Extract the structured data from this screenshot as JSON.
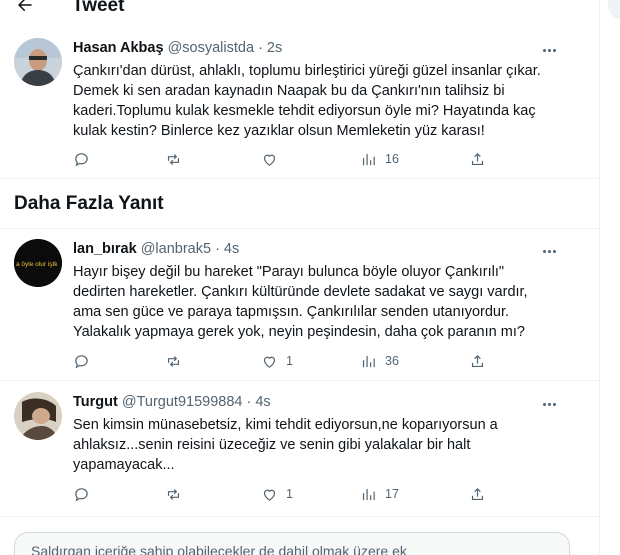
{
  "header": {
    "title": "Tweet"
  },
  "tweets": [
    {
      "name": "Hasan Akbaş",
      "handle": "@sosyalistda",
      "time": "· 2s",
      "text": "Çankırı'dan dürüst, ahlaklı, toplumu birleştirici yüreği güzel insanlar çıkar. Demek ki sen aradan kaynadın Naapak bu da Çankırı'nın talihsiz bi kaderi.Toplumu kulak kesmekle tehdit ediyorsun öyle mi? Hayatında kaç kulak kestin? Binlerce kez yazıklar olsun Memleketin yüz karası!",
      "likes": "",
      "views": "16"
    },
    {
      "name": "lan_bırak",
      "handle": "@lanbrak5",
      "time": "· 4s",
      "avatar_text": "a öyle olur iştk",
      "text": "Hayır bişey değil bu hareket \"Parayı bulunca böyle oluyor Çankırılı\" dedirten hareketler. Çankırı kültüründe devlete sadakat ve saygı vardır, ama sen güce ve paraya tapmışsın. Çankırılılar senden utanıyordur. Yalakalık yapmaya gerek yok, neyin peşindesin, daha çok paranın mı?",
      "likes": "1",
      "views": "36"
    },
    {
      "name": "Turgut",
      "handle": "@Turgut91599884",
      "time": "· 4s",
      "text": "Sen kimsin münasebetsiz, kimi tehdit ediyorsun,ne koparıyorsun a ahlaksız...senin reisini üzeceğiz ve senin gibi yalakalar bir halt yapamayacak...",
      "likes": "1",
      "views": "17"
    }
  ],
  "section": {
    "more_replies": "Daha Fazla Yanıt"
  },
  "notice": {
    "text": "Saldırgan içeriğe sahip olabilecekler de dahil olmak üzere ek"
  },
  "icons": [
    "back-arrow-icon",
    "more-icon",
    "reply-icon",
    "retweet-icon",
    "like-icon",
    "views-icon",
    "share-icon"
  ],
  "colors": {
    "text": "#0f1419",
    "muted": "#536471",
    "border": "#eff3f4"
  }
}
